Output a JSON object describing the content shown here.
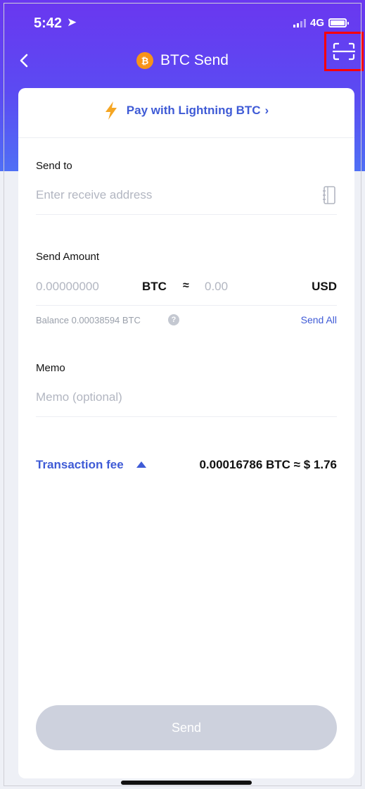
{
  "status_bar": {
    "time": "5:42",
    "network": "4G"
  },
  "header": {
    "title": "BTC Send",
    "coin_symbol": "₿"
  },
  "lightning": {
    "label": "Pay with Lightning BTC",
    "chevron": "›"
  },
  "send_to": {
    "label": "Send to",
    "placeholder": "Enter receive address"
  },
  "amount": {
    "label": "Send Amount",
    "btc_placeholder": "0.00000000",
    "btc_unit": "BTC",
    "approx": "≈",
    "usd_placeholder": "0.00",
    "usd_unit": "USD",
    "balance": "Balance 0.00038594 BTC",
    "help": "?",
    "send_all": "Send All"
  },
  "memo": {
    "label": "Memo",
    "placeholder": "Memo (optional)"
  },
  "fee": {
    "label": "Transaction fee",
    "value": "0.00016786 BTC ≈ $ 1.76"
  },
  "actions": {
    "send": "Send"
  },
  "colors": {
    "header_top": "#6a37f0",
    "header_bottom": "#4f6ff5",
    "accent": "#3f5bd6",
    "lightning": "#f5a623",
    "btc": "#f7931a",
    "send_disabled": "#cdd1dd",
    "highlight_box": "#ff0000"
  },
  "icons": {
    "back": "chevron-left-icon",
    "scan": "scan-icon",
    "lightning": "lightning-bolt-icon",
    "address_book": "address-book-icon",
    "help": "help-circle-icon",
    "fee_toggle": "triangle-up-icon"
  }
}
